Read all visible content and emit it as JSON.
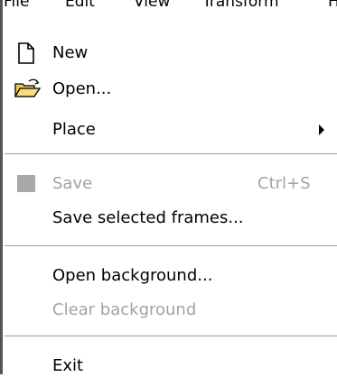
{
  "menubar": {
    "items": [
      "File",
      "Edit",
      "View",
      "Transform",
      "H"
    ]
  },
  "menu": {
    "new": {
      "label": "New",
      "icon": "new-document-icon"
    },
    "open": {
      "label": "Open...",
      "icon": "open-folder-icon"
    },
    "place": {
      "label": "Place"
    },
    "save": {
      "label": "Save",
      "shortcut": "Ctrl+S",
      "icon": "save-icon"
    },
    "save_selected": {
      "label": "Save selected frames..."
    },
    "open_background": {
      "label": "Open background..."
    },
    "clear_background": {
      "label": "Clear background"
    },
    "exit": {
      "label": "Exit"
    }
  },
  "colors": {
    "disabled_text": "#a3a3a3",
    "separator": "#9b9b9b",
    "folder_yellow": "#f2c94c"
  }
}
